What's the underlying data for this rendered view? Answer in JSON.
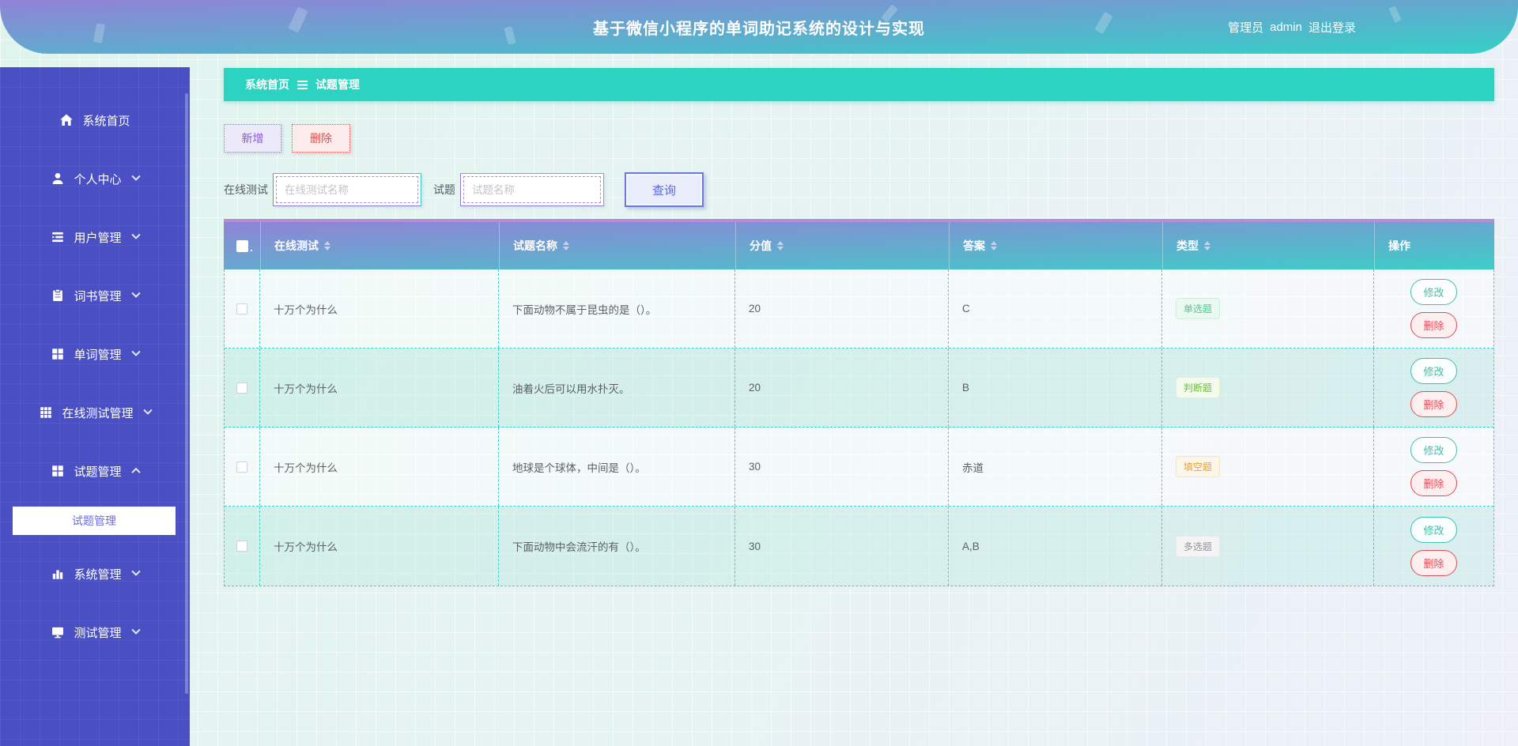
{
  "header": {
    "title": "基于微信小程序的单词助记系统的设计与实现",
    "admin_role": "管理员",
    "admin_name": "admin",
    "logout_label": "退出登录"
  },
  "sidebar": {
    "items": [
      {
        "key": "home",
        "label": "系统首页",
        "icon": "home",
        "has_children": false
      },
      {
        "key": "personal-center",
        "label": "个人中心",
        "icon": "user",
        "has_children": true
      },
      {
        "key": "user-manage",
        "label": "用户管理",
        "icon": "list",
        "has_children": true
      },
      {
        "key": "wordbook-manage",
        "label": "词书管理",
        "icon": "notebook",
        "has_children": true
      },
      {
        "key": "word-manage",
        "label": "单词管理",
        "icon": "grid4",
        "has_children": true
      },
      {
        "key": "online-test-manage",
        "label": "在线测试管理",
        "icon": "grid9",
        "has_children": true
      },
      {
        "key": "question-manage",
        "label": "试题管理",
        "icon": "grid4",
        "has_children": true,
        "expanded": true,
        "children": [
          {
            "key": "question-manage-sub",
            "label": "试题管理",
            "active": true
          }
        ]
      },
      {
        "key": "system-manage",
        "label": "系统管理",
        "icon": "chart",
        "has_children": true
      },
      {
        "key": "test-manage",
        "label": "测试管理",
        "icon": "monitor",
        "has_children": true
      }
    ]
  },
  "breadcrumb": {
    "items": [
      "系统首页",
      "试题管理"
    ]
  },
  "toolbar": {
    "add_label": "新增",
    "delete_label": "删除"
  },
  "search": {
    "online_test_label": "在线测试",
    "online_test_placeholder": "在线测试名称",
    "online_test_value": "",
    "question_label": "试题",
    "question_placeholder": "试题名称",
    "question_value": "",
    "query_label": "查询"
  },
  "table": {
    "columns": [
      "在线测试",
      "试题名称",
      "分值",
      "答案",
      "类型",
      "操作"
    ],
    "actions": {
      "edit": "修改",
      "delete": "删除"
    },
    "rows": [
      {
        "online_test": "十万个为什么",
        "question": "下面动物不属于昆虫的是（）。",
        "score": "20",
        "answer": "C",
        "type": "单选题",
        "type_style": "success"
      },
      {
        "online_test": "十万个为什么",
        "question": "油着火后可以用水扑灭。",
        "score": "20",
        "answer": "B",
        "type": "判断题",
        "type_style": "green"
      },
      {
        "online_test": "十万个为什么",
        "question": "地球是个球体，中间是（）。",
        "score": "30",
        "answer": "赤道",
        "type": "填空题",
        "type_style": "warning"
      },
      {
        "online_test": "十万个为什么",
        "question": "下面动物中会流汗的有（）。",
        "score": "30",
        "answer": "A,B",
        "type": "多选题",
        "type_style": "info"
      }
    ]
  },
  "colors": {
    "header-top": "#9182d7",
    "header-bottom": "#38cdc7",
    "sidebar-bg": "#4a50c4",
    "breadcrumb-bg": "#2dd3c1",
    "table-strip": "#b48edc",
    "th-top": "#9083d7",
    "th-bottom": "#3ecdc7",
    "dashed": "#38d3c3",
    "teal-btn": "#3fc0aa",
    "danger": "#e14d55",
    "success-green": "#43cf8c",
    "tag-green": "#67c23a",
    "warning-orange": "#e6a23c",
    "info-gray": "#909399"
  }
}
